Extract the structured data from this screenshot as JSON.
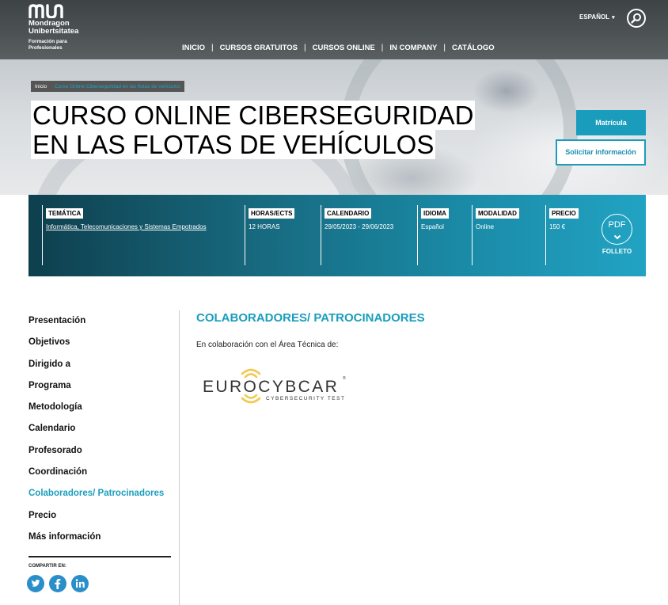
{
  "header": {
    "logo_line1": "Mondragon",
    "logo_line2": "Unibertsitatea",
    "logo_tagline": "Formación para Profesionales",
    "nav": [
      "INICIO",
      "CURSOS GRATUITOS",
      "CURSOS ONLINE",
      "IN COMPANY",
      "CATÁLOGO"
    ],
    "nav_separator": "|",
    "language": "ESPAÑOL",
    "icons": {
      "search": "search-icon",
      "language_caret": "chevron-down-icon"
    }
  },
  "hero": {
    "breadcrumb_home": "Inicio",
    "breadcrumb_current": "Curso Online Ciberseguridad en las flotas de vehículos",
    "title_line1": "CURSO ONLINE CIBERSEGURIDAD",
    "title_line2": "EN LAS FLOTAS DE VEHÍCULOS",
    "button_enroll": "Matrícula",
    "button_request": "Solicitar información"
  },
  "info": {
    "columns": [
      {
        "label": "TEMÁTICA",
        "value": "Informática, Telecomunicaciones y Sistemas Empotrados"
      },
      {
        "label": "HORAS/ECTS",
        "value": "12 HORAS"
      },
      {
        "label": "CALENDARIO",
        "value": "29/05/2023 - 29/06/2023"
      },
      {
        "label": "IDIOMA",
        "value": "Español"
      },
      {
        "label": "MODALIDAD",
        "value": "Online"
      },
      {
        "label": "PRECIO",
        "value": "150 €"
      }
    ],
    "pdf_label": "PDF",
    "brochure_label": "FOLLETO"
  },
  "sidebar": {
    "items": [
      "Presentación",
      "Objetivos",
      "Dirigido a",
      "Programa",
      "Metodología",
      "Calendario",
      "Profesorado",
      "Coordinación",
      "Colaboradores/ Patrocinadores",
      "Precio",
      "Más información"
    ],
    "active_index": 8,
    "share_label": "COMPARTIR EN:",
    "socials": [
      "twitter-icon",
      "facebook-icon",
      "linkedin-icon"
    ]
  },
  "main": {
    "section_title": "COLABORADORES/ PATROCINADORES",
    "collab_text": "En colaboración con el Área Técnica de:",
    "sponsor_logo_text": "EUROCYBCAR",
    "sponsor_logo_sub": "CYBERSECURITY TEST"
  },
  "colors": {
    "accent": "#1a9dbd",
    "header_bg": "#4a5052",
    "band_dark": "#0e3f4d",
    "band_light": "#22a3c3",
    "social": "#2a8fc9",
    "logo_gold": "#f2c94c"
  }
}
